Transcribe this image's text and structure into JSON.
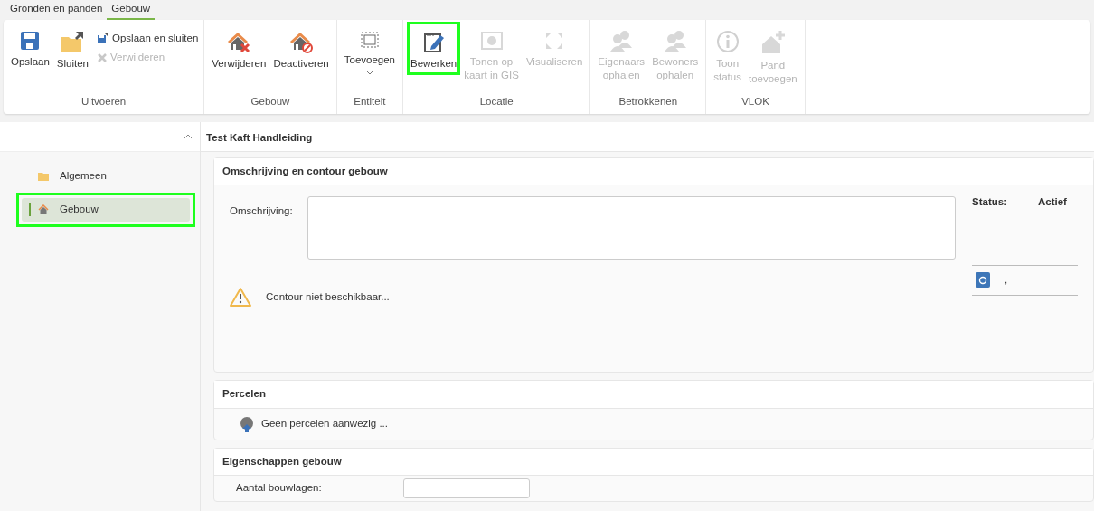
{
  "tabs": [
    {
      "label": "Gronden en panden",
      "selected": false
    },
    {
      "label": "Gebouw",
      "selected": true
    }
  ],
  "ribbon": {
    "groups": [
      {
        "label": "Uitvoeren",
        "buttons": [
          {
            "kind": "large",
            "label": "Opslaan",
            "disabled": false,
            "highlighted": false
          },
          {
            "kind": "large",
            "label": "Sluiten",
            "disabled": false,
            "highlighted": false
          },
          {
            "kind": "small",
            "label": "Opslaan en sluiten",
            "disabled": false,
            "highlighted": false
          },
          {
            "kind": "small",
            "label": "Verwijderen",
            "disabled": true,
            "highlighted": false
          }
        ]
      },
      {
        "label": "Gebouw",
        "buttons": [
          {
            "kind": "large",
            "label": "Verwijderen",
            "disabled": false,
            "highlighted": false
          },
          {
            "kind": "large",
            "label": "Deactiveren",
            "disabled": false,
            "highlighted": false
          }
        ]
      },
      {
        "label": "Entiteit",
        "buttons": [
          {
            "kind": "dropdown",
            "label": "Toevoegen",
            "disabled": false,
            "highlighted": false
          }
        ]
      },
      {
        "label": "Locatie",
        "buttons": [
          {
            "kind": "large",
            "label": "Bewerken",
            "disabled": false,
            "highlighted": true
          },
          {
            "kind": "large",
            "label": "Tonen op\nkaart in GIS",
            "disabled": true,
            "highlighted": false
          },
          {
            "kind": "large",
            "label": "Visualiseren",
            "disabled": true,
            "highlighted": false
          }
        ]
      },
      {
        "label": "Betrokkenen",
        "buttons": [
          {
            "kind": "large",
            "label": "Eigenaars\nophalen",
            "disabled": true,
            "highlighted": false
          },
          {
            "kind": "large",
            "label": "Bewoners\nophalen",
            "disabled": true,
            "highlighted": false
          }
        ]
      },
      {
        "label": "VLOK",
        "buttons": [
          {
            "kind": "large",
            "label": "Toon\nstatus",
            "disabled": true,
            "highlighted": false
          },
          {
            "kind": "large",
            "label": "Pand\ntoevoegen",
            "disabled": true,
            "highlighted": false
          }
        ]
      }
    ]
  },
  "sidebar": {
    "items": [
      {
        "label": "Algemeen",
        "selected": false,
        "highlighted": false
      },
      {
        "label": "Gebouw",
        "selected": true,
        "highlighted": true
      }
    ]
  },
  "main": {
    "title": "Test Kaft Handleiding",
    "sections": [
      {
        "kind": "description",
        "title": "Omschrijving en contour gebouw",
        "field_label": "Omschrijving:",
        "status_label": "Status:",
        "status_value": "Actief",
        "contour_message": "Contour niet beschikbaar...",
        "address": ","
      },
      {
        "kind": "parcels",
        "title": "Percelen",
        "message": "Geen percelen aanwezig ..."
      },
      {
        "kind": "properties",
        "title": "Eigenschappen gebouw",
        "field_label": "Aantal bouwlagen:"
      }
    ]
  }
}
